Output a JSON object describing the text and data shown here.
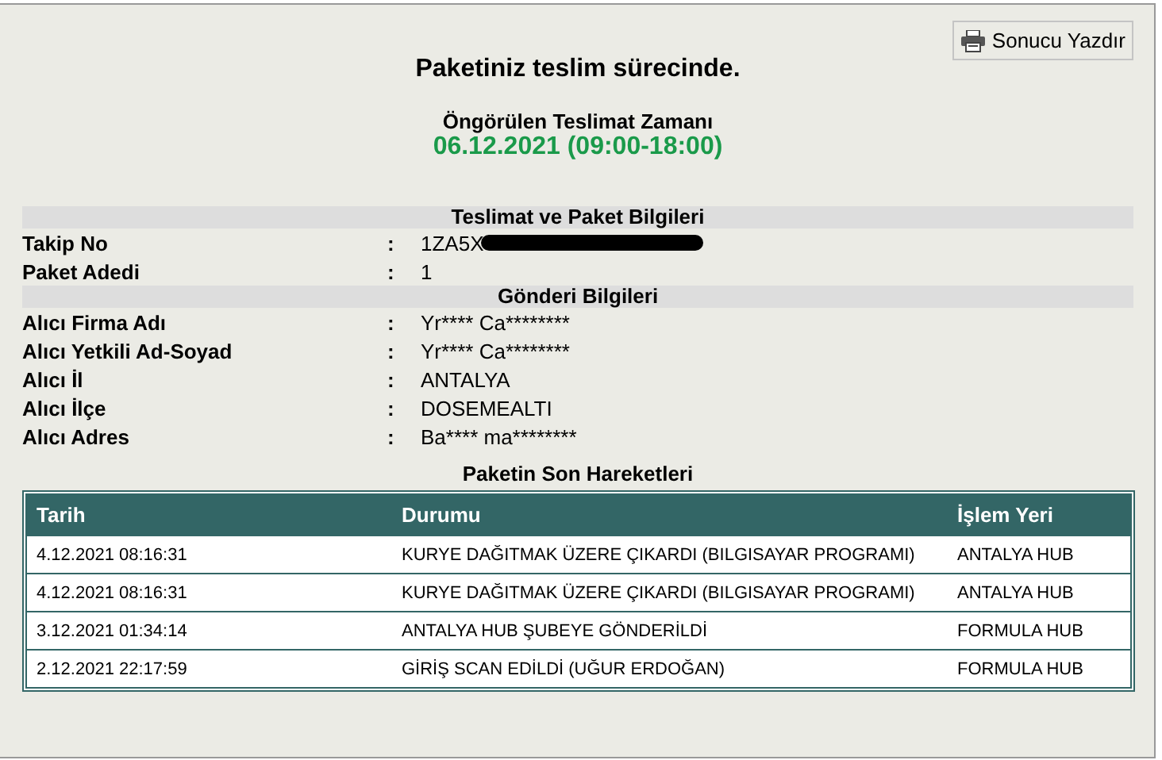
{
  "print_button": {
    "label": "Sonucu Yazdır"
  },
  "headline": "Paketiniz teslim sürecinde.",
  "estimate": {
    "label": "Öngörülen Teslimat Zamanı",
    "value": "06.12.2021 (09:00-18:00)"
  },
  "sections": [
    {
      "title": "Teslimat ve Paket Bilgileri",
      "fields": [
        {
          "label": "Takip No",
          "value": "1ZA5X",
          "redacted": true
        },
        {
          "label": "Paket Adedi",
          "value": "1",
          "redacted": false
        }
      ]
    },
    {
      "title": "Gönderi Bilgileri",
      "fields": [
        {
          "label": "Alıcı Firma Adı",
          "value": "Yr**** Ca********",
          "redacted": false
        },
        {
          "label": "Alıcı Yetkili Ad-Soyad",
          "value": "Yr**** Ca********",
          "redacted": false
        },
        {
          "label": "Alıcı İl",
          "value": "ANTALYA",
          "redacted": false
        },
        {
          "label": "Alıcı İlçe",
          "value": "DOSEMEALTI",
          "redacted": false
        },
        {
          "label": "Alıcı Adres",
          "value": "Ba**** ma********",
          "redacted": false
        }
      ]
    }
  ],
  "separator": ":",
  "movements": {
    "title": "Paketin Son Hareketleri",
    "columns": [
      "Tarih",
      "Durumu",
      "İşlem Yeri"
    ],
    "rows": [
      [
        "4.12.2021 08:16:31",
        "KURYE DAĞITMAK ÜZERE ÇIKARDI (BILGISAYAR PROGRAMI)",
        "ANTALYA HUB"
      ],
      [
        "4.12.2021 08:16:31",
        "KURYE DAĞITMAK ÜZERE ÇIKARDI (BILGISAYAR PROGRAMI)",
        "ANTALYA HUB"
      ],
      [
        "3.12.2021 01:34:14",
        "ANTALYA HUB ŞUBEYE GÖNDERİLDİ",
        "FORMULA HUB"
      ],
      [
        "2.12.2021 22:17:59",
        "GİRİŞ SCAN EDİLDİ (UĞUR ERDOĞAN)",
        "FORMULA HUB"
      ]
    ]
  }
}
